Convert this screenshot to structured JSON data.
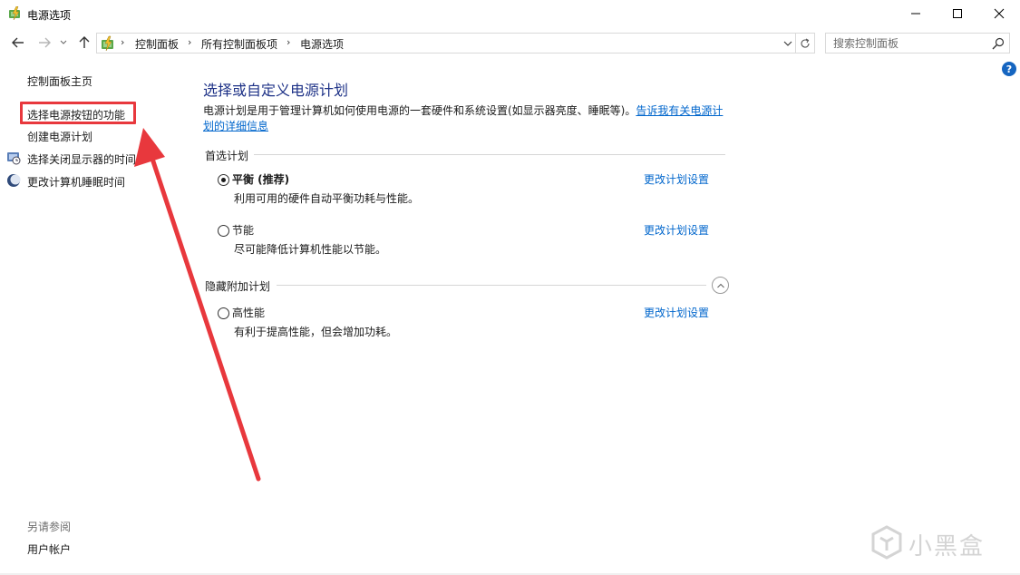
{
  "window": {
    "title": "电源选项",
    "minimize_label": "—",
    "maximize_label": "☐",
    "close_label": "✕"
  },
  "nav": {
    "breadcrumbs": [
      "控制面板",
      "所有控制面板项",
      "电源选项"
    ],
    "separator": "›",
    "search_placeholder": "搜索控制面板"
  },
  "sidebar": {
    "items": [
      {
        "label": "控制面板主页"
      },
      {
        "label": "选择电源按钮的功能"
      },
      {
        "label": "创建电源计划"
      },
      {
        "label": "选择关闭显示器的时间"
      },
      {
        "label": "更改计算机睡眠时间"
      }
    ],
    "see_also_title": "另请参阅",
    "see_also_items": [
      {
        "label": "用户帐户"
      }
    ]
  },
  "main": {
    "title": "选择或自定义电源计划",
    "description": "电源计划是用于管理计算机如何使用电源的一套硬件和系统设置(如显示器亮度、睡眠等)。",
    "description_link": "告诉我有关电源计划的详细信息",
    "preferred_group": "首选计划",
    "hidden_group": "隐藏附加计划",
    "plans": [
      {
        "name": "平衡 (推荐)",
        "desc": "利用可用的硬件自动平衡功耗与性能。",
        "link": "更改计划设置",
        "selected": true
      },
      {
        "name": "节能",
        "desc": "尽可能降低计算机性能以节能。",
        "link": "更改计划设置",
        "selected": false
      },
      {
        "name": "高性能",
        "desc": "有利于提高性能，但会增加功耗。",
        "link": "更改计划设置",
        "selected": false
      }
    ]
  },
  "help_label": "?",
  "watermark": {
    "text": "小黑盒"
  },
  "colors": {
    "accent_title": "#1e3287",
    "link": "#0066cc",
    "annotation_red": "#e8383d"
  }
}
